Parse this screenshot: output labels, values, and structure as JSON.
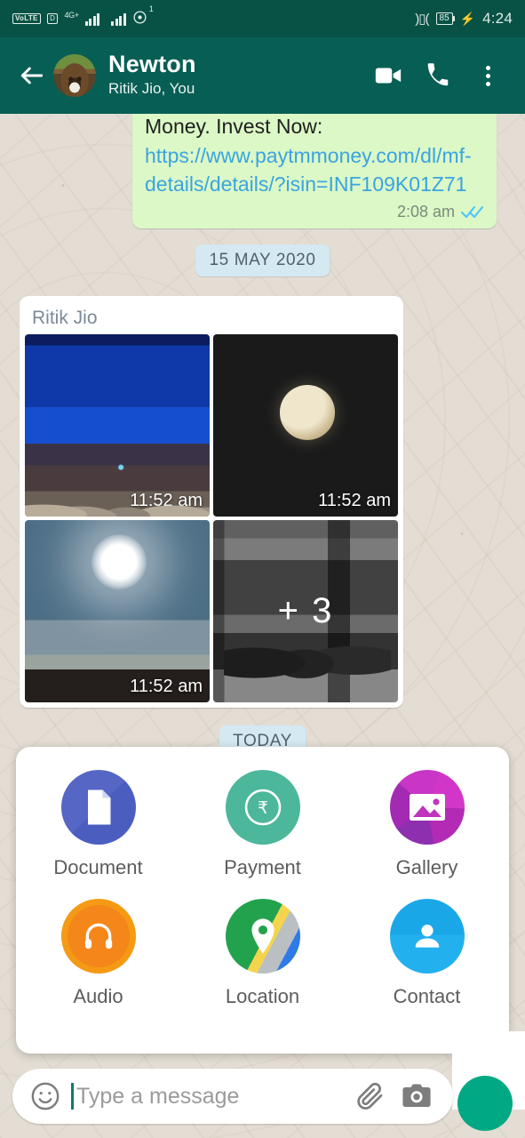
{
  "statusbar": {
    "volte": "VoLTE",
    "sim": "D",
    "network_label": "4G+",
    "hotspot_badge": "1",
    "battery_level": "85",
    "time": "4:24",
    "icons": [
      "volte-icon",
      "sim-icon",
      "signal-bars-icon",
      "signal-bars-secondary-icon",
      "hotspot-icon",
      "vibrate-icon",
      "battery-icon",
      "charging-bolt-icon"
    ]
  },
  "appbar": {
    "back_icon": "back-arrow-icon",
    "avatar": "contact-avatar",
    "title": "Newton",
    "subtitle": "Ritik Jio, You",
    "video_icon": "video-call-icon",
    "call_icon": "phone-call-icon",
    "menu_icon": "overflow-menu-icon",
    "background_color": "#075e54"
  },
  "chat": {
    "background_color": "#e3ddd4",
    "outgoing_message": {
      "text_prefix": "Money. Invest Now: ",
      "link": "https://www.paytmmoney.com/dl/mf-details/details/?isin=INF109K01Z71",
      "time": "2:08 am",
      "status": "read",
      "bubble_color": "#dcf8c6"
    },
    "date_divider": "15 MAY 2020",
    "today_divider": "TODAY",
    "album": {
      "sender": "Ritik Jio",
      "photos": [
        {
          "name": "night-seascape-photo",
          "time": "11:52 am"
        },
        {
          "name": "moon-photo",
          "time": "11:52 am"
        },
        {
          "name": "sun-tree-photo",
          "time": "11:52 am"
        },
        {
          "name": "street-bikes-photo",
          "time": "",
          "more_label": "+ 3"
        }
      ]
    }
  },
  "attach_panel": {
    "items": [
      {
        "label": "Document",
        "icon": "document-icon",
        "color": "#5566c4"
      },
      {
        "label": "Payment",
        "icon": "rupee-icon",
        "color": "#4cb79a"
      },
      {
        "label": "Gallery",
        "icon": "gallery-icon",
        "color": "#c935c6"
      },
      {
        "label": "Audio",
        "icon": "headphones-icon",
        "color": "#f5861a"
      },
      {
        "label": "Location",
        "icon": "map-pin-icon",
        "color": "#23a24d"
      },
      {
        "label": "Contact",
        "icon": "person-icon",
        "color": "#1aa7e8"
      }
    ]
  },
  "inputbar": {
    "emoji_icon": "emoji-icon",
    "placeholder": "Type a message",
    "value": "",
    "attach_icon": "paperclip-icon",
    "camera_icon": "camera-icon",
    "mic_icon": "mic-button"
  }
}
